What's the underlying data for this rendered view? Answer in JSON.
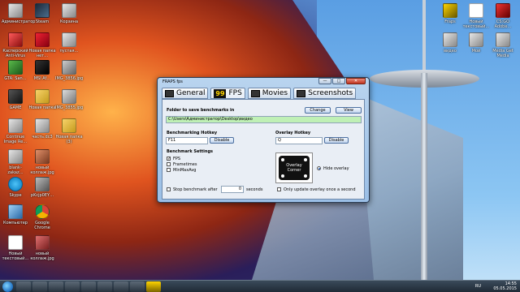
{
  "desktop": {
    "icons": [
      {
        "label": "Администратор",
        "name": "desktop-icon-admin"
      },
      {
        "label": "Steam",
        "name": "desktop-icon-steam"
      },
      {
        "label": "Корзина",
        "name": "desktop-icon-recycle"
      },
      {
        "label": "Касперский Anti-Virus",
        "name": "desktop-icon-kaspersky"
      },
      {
        "label": "Новая папка нет…",
        "name": "desktop-icon-folder"
      },
      {
        "label": "пустая…",
        "name": "desktop-icon-empty"
      },
      {
        "label": "GTA: San…",
        "name": "desktop-icon-gta"
      },
      {
        "label": "MSI Af…",
        "name": "desktop-icon-msi"
      },
      {
        "label": "IMG_3856.jpg",
        "name": "desktop-icon-img1"
      },
      {
        "label": "GAME",
        "name": "desktop-icon-game"
      },
      {
        "label": "Новая папка",
        "name": "desktop-icon-newfolder"
      },
      {
        "label": "IMG_3855.jpg",
        "name": "desktop-icon-img2"
      },
      {
        "label": "Continue Image Re…",
        "name": "desktop-icon-continue"
      },
      {
        "label": "часть.dc3",
        "name": "desktop-icon-dc3"
      },
      {
        "label": "Новая папка (3)",
        "name": "desktop-icon-newfolder3"
      },
      {
        "label": "blank-zakaz…",
        "name": "desktop-icon-blank"
      },
      {
        "label": "новый коллаж.jpg",
        "name": "desktop-icon-collage1"
      },
      {
        "label": "Skype",
        "name": "desktop-icon-skype"
      },
      {
        "label": "pKcjp0EY…",
        "name": "desktop-icon-pk"
      },
      {
        "label": "Компьютер",
        "name": "desktop-icon-computer"
      },
      {
        "label": "Google Chrome",
        "name": "desktop-icon-chrome"
      },
      {
        "label": "Новый текстовый…",
        "name": "desktop-icon-txt"
      },
      {
        "label": "новый коллаж.jpg",
        "name": "desktop-icon-collage2"
      },
      {
        "label": "Fraps",
        "name": "desktop-icon-fraps"
      },
      {
        "label": "Новый текстовый…",
        "name": "desktop-icon-txt2"
      },
      {
        "label": "CS:GO Adobe…",
        "name": "desktop-icon-csgo"
      },
      {
        "label": "видео",
        "name": "desktop-icon-video"
      },
      {
        "label": "Мой",
        "name": "desktop-icon-my"
      },
      {
        "label": "Media Get Media",
        "name": "desktop-icon-mediaget"
      }
    ]
  },
  "window": {
    "title": "FRAPS fps",
    "minimize": "—",
    "maximize": "□",
    "close": "✕",
    "tabs": [
      {
        "label": "General"
      },
      {
        "label": "FPS",
        "badge": "99"
      },
      {
        "label": "Movies"
      },
      {
        "label": "Screenshots"
      }
    ],
    "folder_label": "Folder to save benchmarks in",
    "change_button": "Change",
    "view_button": "View",
    "folder_path": "C:\\Users\\Администратор\\Desktop\\видео",
    "benchmark_hotkey_label": "Benchmarking Hotkey",
    "benchmark_hotkey_value": "F11",
    "benchmark_disable": "Disable",
    "overlay_hotkey_label": "Overlay Hotkey",
    "overlay_hotkey_value": "Q",
    "overlay_disable": "Disable",
    "benchmark_settings_label": "Benchmark Settings",
    "opt_fps": "FPS",
    "opt_frametimes": "Frametimes",
    "opt_minmaxavg": "MinMaxAvg",
    "overlay_corner_line1": "Overlay",
    "overlay_corner_line2": "Corner",
    "hide_overlay": "Hide overlay",
    "stop_benchmark_after": "Stop benchmark after",
    "stop_seconds_value": "0",
    "seconds_label": "seconds",
    "only_update_overlay": "Only update overlay once a second"
  },
  "taskbar": {
    "language": "RU",
    "time": "14:55",
    "date": "05.05.2015"
  },
  "colors": {
    "folder_field_bg": "#bff0b5",
    "window_frame": "#9bbfe6"
  }
}
